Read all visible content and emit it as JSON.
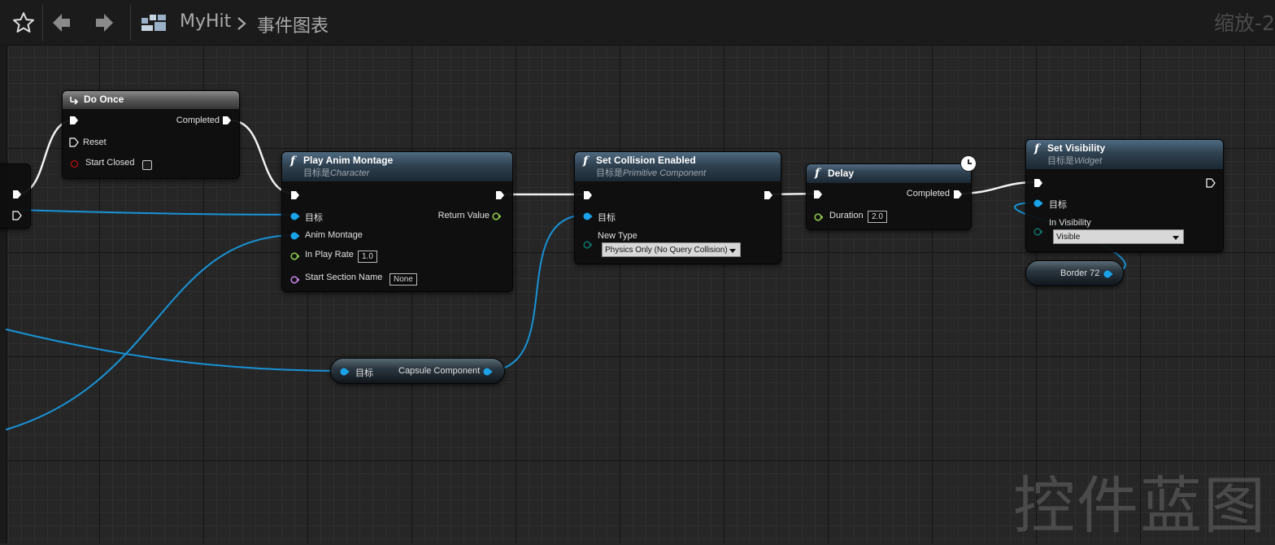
{
  "toolbar": {
    "breadcrumb_root": "MyHit",
    "breadcrumb_page": "事件图表",
    "zoom_label": "缩放-2"
  },
  "watermark": "控件蓝图",
  "colors": {
    "exec_wire": "#f2f2f2",
    "object_wire": "#1893d6",
    "object_pin": "#1aa3e8",
    "float_pin": "#8bc34a",
    "name_pin": "#c07ee0",
    "bool_pin": "#9b0f0f",
    "enum_pin": "#0e6e66"
  },
  "nodes": {
    "do_once": {
      "title": "Do Once",
      "out_completed": "Completed",
      "in_reset": "Reset",
      "in_start_closed": "Start Closed"
    },
    "play_anim_montage": {
      "title": "Play Anim Montage",
      "target_prefix": "目标是",
      "target_class": "Character",
      "pin_target": "目标",
      "pin_anim_montage": "Anim Montage",
      "pin_in_play_rate": "In Play Rate",
      "in_play_rate_value": "1.0",
      "pin_start_section": "Start Section Name",
      "start_section_value": "None",
      "out_return_value": "Return Value"
    },
    "set_collision_enabled": {
      "title": "Set Collision Enabled",
      "target_prefix": "目标是",
      "target_class": "Primitive Component",
      "pin_target": "目标",
      "pin_new_type": "New Type",
      "new_type_value": "Physics Only (No Query Collision)"
    },
    "delay": {
      "title": "Delay",
      "out_completed": "Completed",
      "pin_duration": "Duration",
      "duration_value": "2.0"
    },
    "set_visibility": {
      "title": "Set Visibility",
      "target_prefix": "目标是",
      "target_class": "Widget",
      "pin_target": "目标",
      "pin_in_visibility": "In Visibility",
      "in_visibility_value": "Visible"
    },
    "capsule_getter": {
      "pin_target": "目标",
      "out_label": "Capsule Component"
    },
    "border_var": {
      "label": "Border 72"
    }
  }
}
